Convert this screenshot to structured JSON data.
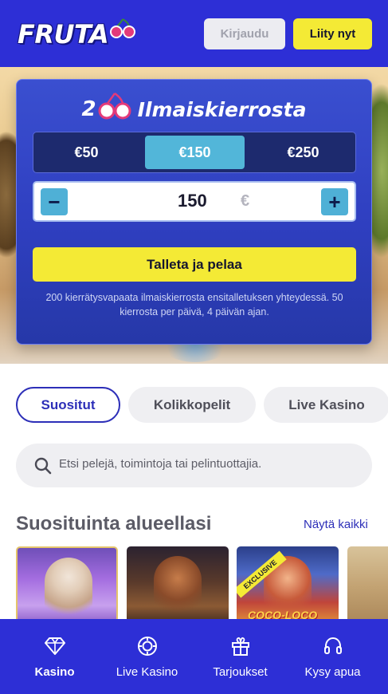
{
  "header": {
    "logo_text": "FRUTA",
    "login_label": "Kirjaudu",
    "join_label": "Liity nyt"
  },
  "promo": {
    "title_number": "200",
    "title_text": "Ilmaiskierrosta",
    "amount_options": [
      "€50",
      "€150",
      "€250"
    ],
    "selected_amount_index": 1,
    "stepper_value": "150",
    "stepper_currency": "€",
    "minus_label": "−",
    "plus_label": "+",
    "deposit_button": "Talleta ja pelaa",
    "terms": "200 kierrätysvapaata ilmaiskierrosta ensitalletuksen yhteydessä. 50 kierrosta per päivä, 4 päivän ajan."
  },
  "categories": [
    "Suositut",
    "Kolikkopelit",
    "Live Kasino"
  ],
  "selected_category_index": 0,
  "search": {
    "placeholder": "Etsi pelejä, toimintoja tai pelintuottajia."
  },
  "section": {
    "title": "Suosituinta alueellasi",
    "link": "Näytä kaikki"
  },
  "games": [
    {
      "badge": "",
      "title": ""
    },
    {
      "badge": "",
      "title": ""
    },
    {
      "badge": "EXCLUSIVE",
      "title": "COCO-LOCO"
    },
    {
      "badge": "",
      "title": ""
    }
  ],
  "bottom_nav": {
    "items": [
      {
        "label": "Kasino",
        "icon": "diamond-icon"
      },
      {
        "label": "Live Kasino",
        "icon": "chip-icon"
      },
      {
        "label": "Tarjoukset",
        "icon": "gift-icon"
      },
      {
        "label": "Kysy apua",
        "icon": "headset-icon"
      }
    ],
    "active_index": 0
  },
  "colors": {
    "brand_blue": "#2d2fd6",
    "accent_yellow": "#f4ea35",
    "selected_tab": "#52b6d9"
  }
}
